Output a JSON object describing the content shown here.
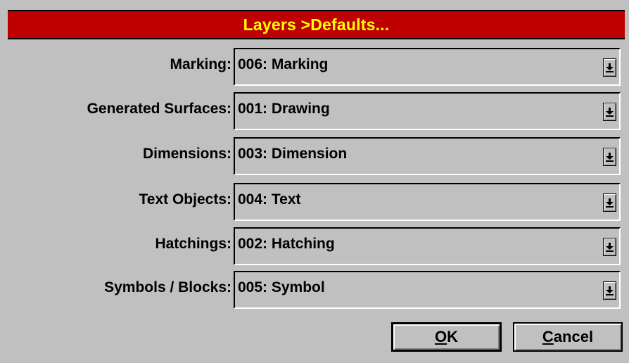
{
  "dialog": {
    "title": "Layers >Defaults...",
    "title_bar_color": "#bf0000",
    "title_text_color": "#ffff00",
    "background_color": "#c0c0c0"
  },
  "fields": [
    {
      "label": "Marking:",
      "value": "006: Marking"
    },
    {
      "label": "Generated Surfaces:",
      "value": "001: Drawing"
    },
    {
      "label": "Dimensions:",
      "value": "003: Dimension"
    },
    {
      "label": "Text Objects:",
      "value": "004: Text"
    },
    {
      "label": "Hatchings:",
      "value": "002: Hatching"
    },
    {
      "label": "Symbols / Blocks:",
      "value": "005: Symbol"
    }
  ],
  "dropdown_icon": "dropdown-arrow-icon",
  "buttons": {
    "ok": {
      "mnemonic": "O",
      "rest": "K"
    },
    "cancel": {
      "mnemonic": "C",
      "rest": "ancel"
    }
  }
}
